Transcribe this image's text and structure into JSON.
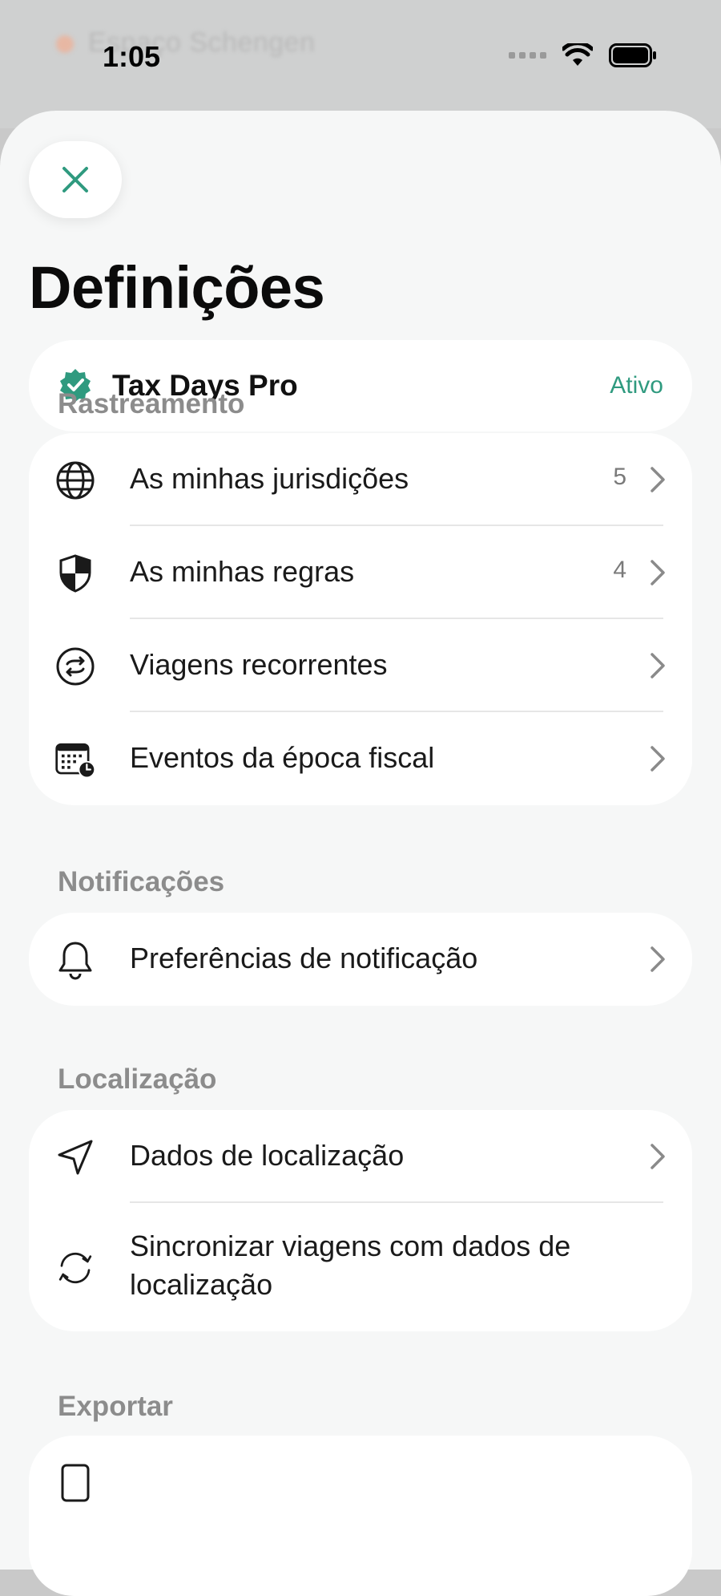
{
  "background": {
    "blurred_title": "Espaço Schengen"
  },
  "status_bar": {
    "time": "1:05"
  },
  "title": "Definições",
  "pro": {
    "name": "Tax Days Pro",
    "status": "Ativo"
  },
  "sections": {
    "tracking": {
      "header": "Rastreamento",
      "items": [
        {
          "label": "As minhas jurisdições",
          "count": "5",
          "icon": "globe-icon"
        },
        {
          "label": "As minhas regras",
          "count": "4",
          "icon": "shield-icon"
        },
        {
          "label": "Viagens recorrentes",
          "icon": "repeat-icon"
        },
        {
          "label": "Eventos da época fiscal",
          "icon": "calendar-clock-icon"
        }
      ]
    },
    "notifications": {
      "header": "Notificações",
      "items": [
        {
          "label": "Preferências de notificação",
          "icon": "bell-icon"
        }
      ]
    },
    "location": {
      "header": "Localização",
      "items": [
        {
          "label": "Dados de localização",
          "icon": "location-arrow-icon"
        },
        {
          "label": "Sincronizar viagens com dados de localização",
          "icon": "sync-icon"
        }
      ]
    },
    "export": {
      "header": "Exportar"
    }
  },
  "colors": {
    "accent": "#2f9a7f",
    "sheet": "#f6f7f7",
    "card": "#ffffff",
    "section_header": "#8c8c8c"
  }
}
